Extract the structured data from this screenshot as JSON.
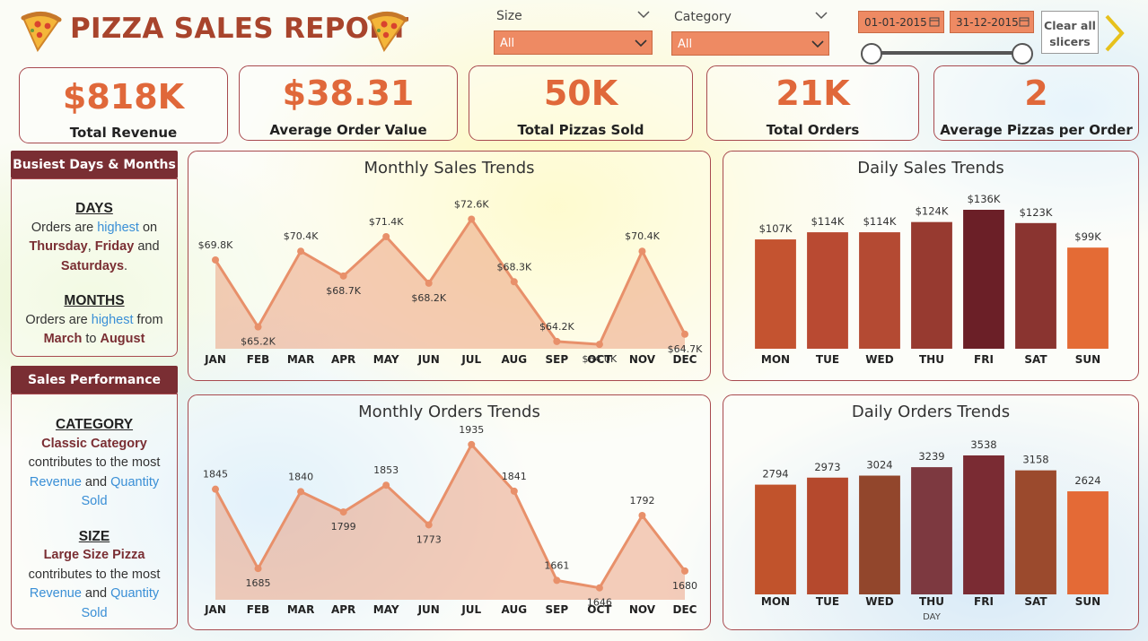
{
  "header": {
    "title": "PIZZA SALES REPORT",
    "logo_icon": "pizza-slice-icon"
  },
  "slicers": {
    "size": {
      "label": "Size",
      "value": "All"
    },
    "category": {
      "label": "Category",
      "value": "All"
    },
    "date_start": "01-01-2015",
    "date_end": "31-12-2015",
    "clear_label_1": "Clear all",
    "clear_label_2": "slicers",
    "next_icon": "chevron-right-icon"
  },
  "kpis": [
    {
      "value": "$818K",
      "label": "Total Revenue"
    },
    {
      "value": "$38.31",
      "label": "Average Order Value"
    },
    {
      "value": "50K",
      "label": "Total Pizzas Sold"
    },
    {
      "value": "21K",
      "label": "Total Orders"
    },
    {
      "value": "2",
      "label": "Average Pizzas per Order"
    }
  ],
  "busiest": {
    "header": "Busiest Days & Months",
    "days_heading": "DAYS",
    "days_l1a": "Orders are ",
    "days_l1b": "highest",
    "days_l1c": " on",
    "days_d1": "Thursday",
    "days_sep1": ", ",
    "days_d2": "Friday",
    "days_and": " and",
    "days_d3": "Saturdays",
    "days_end": ".",
    "months_heading": "MONTHS",
    "months_l1a": "Orders are ",
    "months_l1b": "highest",
    "months_l1c": " from",
    "months_m1": "March",
    "months_to": " to ",
    "months_m2": "August"
  },
  "performance": {
    "header": "Sales Performance",
    "cat_heading": "CATEGORY",
    "cat_name": "Classic Category",
    "cat_l2": "contributes to the most",
    "cat_rev": "Revenue",
    "cat_and": " and ",
    "cat_qty": "Quantity",
    "cat_sold": "Sold",
    "size_heading": "SIZE",
    "size_name": "Large Size Pizza",
    "size_l2": "contributes to the most",
    "size_rev": "Revenue",
    "size_and": " and ",
    "size_qty": "Quantity",
    "size_sold": "Sold"
  },
  "chart_data": [
    {
      "id": "monthly-sales",
      "type": "area",
      "title": "Monthly Sales Trends",
      "categories": [
        "JAN",
        "FEB",
        "MAR",
        "APR",
        "MAY",
        "JUN",
        "JUL",
        "AUG",
        "SEP",
        "OCT",
        "NOV",
        "DEC"
      ],
      "values": [
        69.8,
        65.2,
        70.4,
        68.7,
        71.4,
        68.2,
        72.6,
        68.3,
        64.2,
        64.0,
        70.4,
        64.7
      ],
      "labels": [
        "$69.8K",
        "$65.2K",
        "$70.4K",
        "$68.7K",
        "$71.4K",
        "$68.2K",
        "$72.6K",
        "$68.3K",
        "$64.2K",
        "$64.0K",
        "$70.4K",
        "$64.7K"
      ],
      "ylim": [
        63.7,
        73.0
      ],
      "color": "#e8906a"
    },
    {
      "id": "monthly-orders",
      "type": "area",
      "title": "Monthly Orders Trends",
      "categories": [
        "JAN",
        "FEB",
        "MAR",
        "APR",
        "MAY",
        "JUN",
        "JUL",
        "AUG",
        "SEP",
        "OCT",
        "NOV",
        "DEC"
      ],
      "values": [
        1845,
        1685,
        1840,
        1799,
        1853,
        1773,
        1935,
        1841,
        1661,
        1646,
        1792,
        1680
      ],
      "labels": [
        "1845",
        "1685",
        "1840",
        "1799",
        "1853",
        "1773",
        "1935",
        "1841",
        "1661",
        "1646",
        "1792",
        "1680"
      ],
      "ylim": [
        1622,
        1942
      ],
      "color": "#e8906a"
    },
    {
      "id": "daily-sales",
      "type": "bar",
      "title": "Daily Sales Trends",
      "categories": [
        "MON",
        "TUE",
        "WED",
        "THU",
        "FRI",
        "SAT",
        "SUN"
      ],
      "values": [
        107,
        114,
        114,
        124,
        136,
        123,
        99
      ],
      "labels": [
        "$107K",
        "$114K",
        "$114K",
        "$124K",
        "$136K",
        "$123K",
        "$99K"
      ],
      "colors": [
        "#c45330",
        "#b94a32",
        "#b44a33",
        "#973a30",
        "#6b1f27",
        "#8a3430",
        "#e46b35"
      ],
      "ylim": [
        0,
        136
      ]
    },
    {
      "id": "daily-orders",
      "type": "bar",
      "title": "Daily Orders Trends",
      "xlabel": "DAY",
      "categories": [
        "MON",
        "TUE",
        "WED",
        "THU",
        "FRI",
        "SAT",
        "SUN"
      ],
      "values": [
        2794,
        2973,
        3024,
        3239,
        3538,
        3158,
        2624
      ],
      "labels": [
        "2794",
        "2973",
        "3024",
        "3239",
        "3538",
        "3158",
        "2624"
      ],
      "colors": [
        "#c1532c",
        "#b5492d",
        "#92462c",
        "#7d3940",
        "#7a2b33",
        "#9b4a2d",
        "#e46a36"
      ],
      "ylim": [
        0,
        3538
      ]
    }
  ]
}
